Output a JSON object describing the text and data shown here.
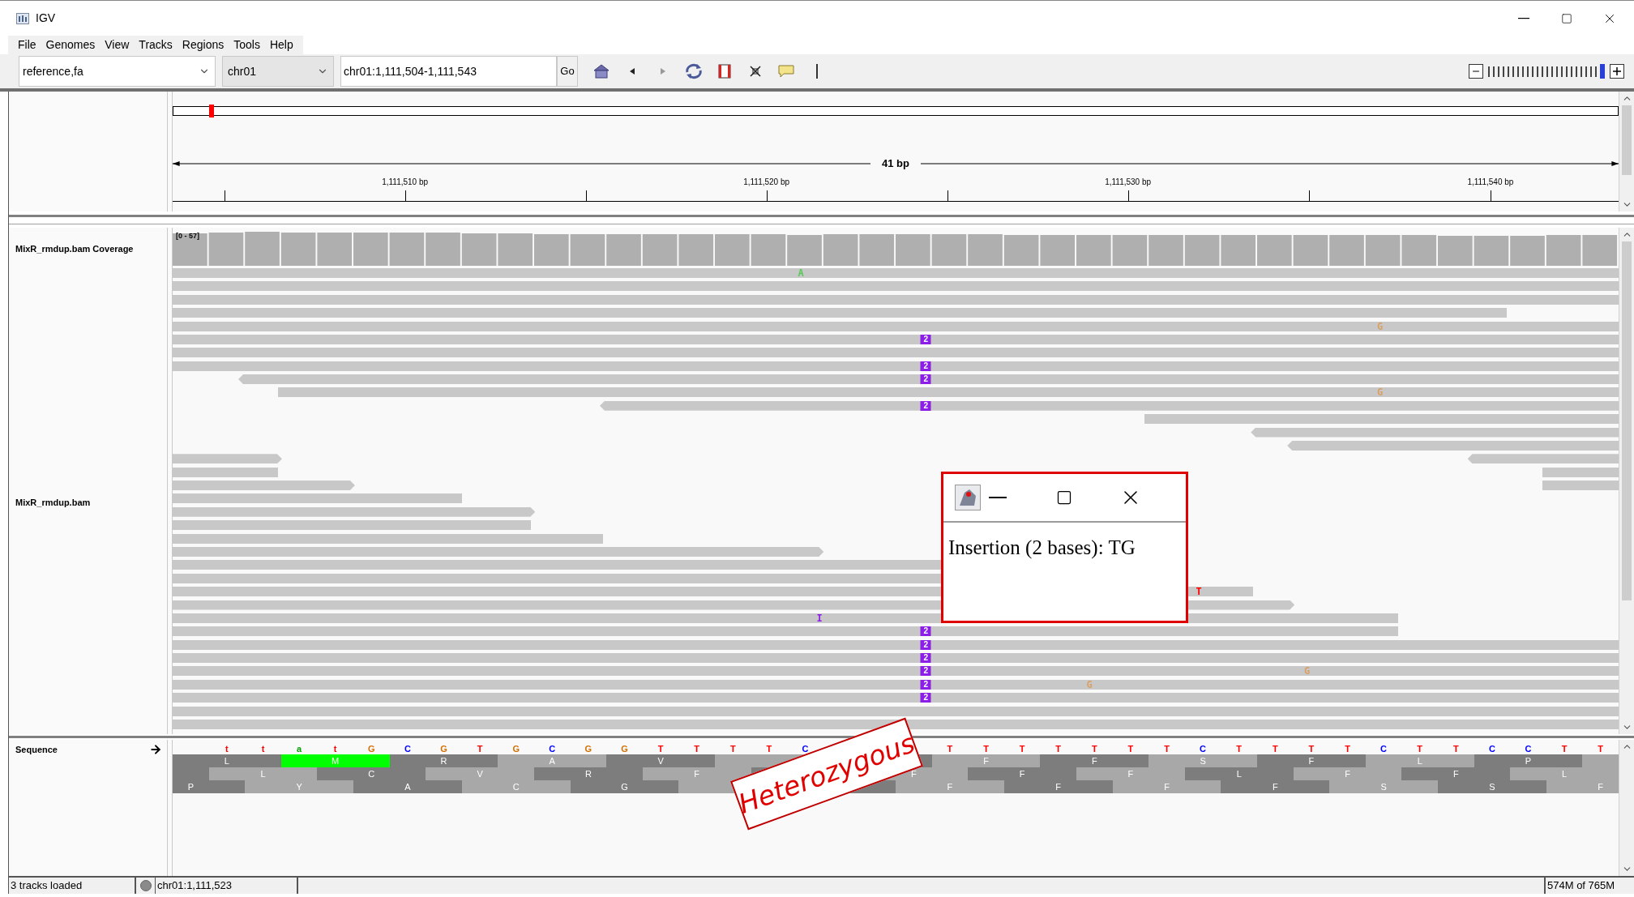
{
  "window": {
    "title": "IGV"
  },
  "menu": [
    "File",
    "Genomes",
    "View",
    "Tracks",
    "Regions",
    "Tools",
    "Help"
  ],
  "toolbar": {
    "genome": "reference,fa",
    "chromosome": "chr01",
    "locus": "chr01:1,111,504-1,111,543",
    "go": "Go",
    "zoom": {
      "level": 1
    }
  },
  "ruler": {
    "span": "41 bp",
    "ticks": [
      "1,111,510 bp",
      "1,111,520 bp",
      "1,111,530 bp",
      "1,111,540 bp"
    ]
  },
  "coverage_track": {
    "name": "MixR_rmdup.bam Coverage",
    "range": "[0 - 57]"
  },
  "alignment_track": {
    "name": "MixR_rmdup.bam",
    "marks": [
      {
        "kind": "mismatch",
        "text": "A",
        "color": "#5ac85a"
      },
      {
        "kind": "mismatch",
        "text": "G",
        "color": "#d9a066"
      },
      {
        "kind": "insertion",
        "text": "2",
        "color": "#8c1ee8"
      },
      {
        "kind": "insertion",
        "text": "2",
        "color": "#8c1ee8"
      },
      {
        "kind": "insertion",
        "text": "2",
        "color": "#8c1ee8"
      },
      {
        "kind": "mismatch",
        "text": "G",
        "color": "#d9a066"
      },
      {
        "kind": "insertion",
        "text": "2",
        "color": "#8c1ee8"
      },
      {
        "kind": "mismatch",
        "text": "T",
        "color": "#ff0000"
      },
      {
        "kind": "mismatch",
        "text": "I",
        "color": "#8c1ee8"
      },
      {
        "kind": "insertion",
        "text": "2",
        "color": "#8c1ee8"
      },
      {
        "kind": "insertion",
        "text": "2",
        "color": "#8c1ee8"
      },
      {
        "kind": "insertion",
        "text": "2",
        "color": "#8c1ee8"
      },
      {
        "kind": "insertion",
        "text": "2",
        "color": "#8c1ee8"
      },
      {
        "kind": "mismatch",
        "text": "G",
        "color": "#d9a066"
      },
      {
        "kind": "insertion",
        "text": "2",
        "color": "#8c1ee8"
      },
      {
        "kind": "mismatch",
        "text": "G",
        "color": "#d9a066"
      },
      {
        "kind": "insertion",
        "text": "2",
        "color": "#8c1ee8"
      }
    ]
  },
  "sequence_track": {
    "name": "Sequence",
    "bases_left": [
      {
        "base": "t",
        "color": "#ff0000"
      },
      {
        "base": "t",
        "color": "#ff0000"
      },
      {
        "base": "a",
        "color": "#00a000"
      },
      {
        "base": "t",
        "color": "#ff0000"
      },
      {
        "base": "G",
        "color": "#d17105"
      },
      {
        "base": "C",
        "color": "#0000ff"
      },
      {
        "base": "G",
        "color": "#d17105"
      },
      {
        "base": "T",
        "color": "#ff0000"
      },
      {
        "base": "G",
        "color": "#d17105"
      },
      {
        "base": "C",
        "color": "#0000ff"
      },
      {
        "base": "G",
        "color": "#d17105"
      },
      {
        "base": "G",
        "color": "#d17105"
      },
      {
        "base": "T",
        "color": "#ff0000"
      },
      {
        "base": "T",
        "color": "#ff0000"
      },
      {
        "base": "T",
        "color": "#ff0000"
      },
      {
        "base": "T",
        "color": "#ff0000"
      },
      {
        "base": "C",
        "color": "#0000ff"
      }
    ],
    "bases_right": [
      {
        "base": "T",
        "color": "#ff0000"
      },
      {
        "base": "T",
        "color": "#ff0000"
      },
      {
        "base": "T",
        "color": "#ff0000"
      },
      {
        "base": "T",
        "color": "#ff0000"
      },
      {
        "base": "T",
        "color": "#ff0000"
      },
      {
        "base": "T",
        "color": "#ff0000"
      },
      {
        "base": "T",
        "color": "#ff0000"
      },
      {
        "base": "C",
        "color": "#0000ff"
      },
      {
        "base": "T",
        "color": "#ff0000"
      },
      {
        "base": "T",
        "color": "#ff0000"
      },
      {
        "base": "T",
        "color": "#ff0000"
      },
      {
        "base": "T",
        "color": "#ff0000"
      },
      {
        "base": "C",
        "color": "#0000ff"
      },
      {
        "base": "T",
        "color": "#ff0000"
      },
      {
        "base": "T",
        "color": "#ff0000"
      },
      {
        "base": "C",
        "color": "#0000ff"
      },
      {
        "base": "C",
        "color": "#0000ff"
      },
      {
        "base": "T",
        "color": "#ff0000"
      },
      {
        "base": "T",
        "color": "#ff0000"
      }
    ],
    "frames": [
      [
        {
          "kind": "codon",
          "aa": "L"
        },
        {
          "kind": "start",
          "aa": "M"
        },
        {
          "kind": "codon",
          "aa": "R"
        },
        {
          "kind": "codon",
          "aa": "A"
        },
        {
          "kind": "codon",
          "aa": "V"
        },
        {
          "kind": "codon"
        },
        {
          "kind": "codon"
        },
        {
          "kind": "codon",
          "aa": "F"
        },
        {
          "kind": "codon",
          "aa": "F"
        },
        {
          "kind": "codon",
          "aa": "S"
        },
        {
          "kind": "codon",
          "aa": "F"
        },
        {
          "kind": "codon",
          "aa": "L"
        },
        {
          "kind": "codon",
          "aa": "P"
        },
        {
          "kind": "codon"
        }
      ],
      [
        {
          "kind": "codon"
        },
        {
          "kind": "codon",
          "aa": "L"
        },
        {
          "kind": "codon",
          "aa": "C"
        },
        {
          "kind": "codon",
          "aa": "V"
        },
        {
          "kind": "codon",
          "aa": "R"
        },
        {
          "kind": "codon",
          "aa": "F"
        },
        {
          "kind": "codon"
        },
        {
          "kind": "codon",
          "aa": "F"
        },
        {
          "kind": "codon",
          "aa": "F"
        },
        {
          "kind": "codon",
          "aa": "F"
        },
        {
          "kind": "codon",
          "aa": "L"
        },
        {
          "kind": "codon",
          "aa": "F"
        },
        {
          "kind": "codon",
          "aa": "F"
        },
        {
          "kind": "codon",
          "aa": "L"
        }
      ],
      [
        {
          "kind": "codon",
          "aa": "P"
        },
        {
          "kind": "codon",
          "aa": "Y"
        },
        {
          "kind": "codon",
          "aa": "A"
        },
        {
          "kind": "codon",
          "aa": "C"
        },
        {
          "kind": "codon",
          "aa": "G"
        },
        {
          "kind": "codon"
        },
        {
          "kind": "codon"
        },
        {
          "kind": "codon",
          "aa": "F"
        },
        {
          "kind": "codon",
          "aa": "F"
        },
        {
          "kind": "codon",
          "aa": "F"
        },
        {
          "kind": "codon",
          "aa": "F"
        },
        {
          "kind": "codon",
          "aa": "S"
        },
        {
          "kind": "codon",
          "aa": "S"
        },
        {
          "kind": "codon",
          "aa": "F"
        }
      ]
    ]
  },
  "popup": {
    "text": "Insertion (2 bases): TG"
  },
  "stamp": {
    "text": "Heterozygous"
  },
  "status_bar": [
    "3 tracks loaded",
    "chr01:1,111,523",
    "574M of 765M"
  ]
}
